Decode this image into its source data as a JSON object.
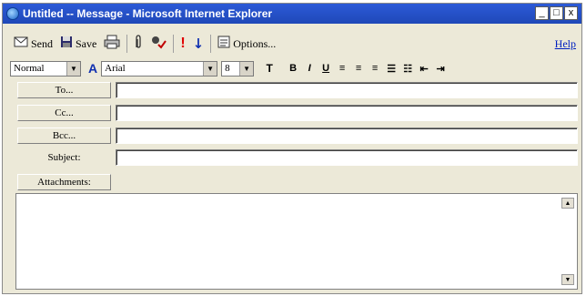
{
  "window": {
    "title": "Untitled -- Message - Microsoft Internet Explorer",
    "minimize": "_",
    "maximize": "□",
    "close": "x"
  },
  "toolbar": {
    "send_label": "Send",
    "save_label": "Save",
    "priority_high_glyph": "!",
    "priority_low_glyph": "↓",
    "options_label": "Options...",
    "help_label": "Help"
  },
  "format": {
    "style_value": "Normal",
    "font_value": "Arial",
    "size_value": "8",
    "bold": "B",
    "italic": "I",
    "underline": "U"
  },
  "fields": {
    "to_label": "To...",
    "cc_label": "Cc...",
    "bcc_label": "Bcc...",
    "subject_label": "Subject:",
    "attachments_label": "Attachments:"
  }
}
